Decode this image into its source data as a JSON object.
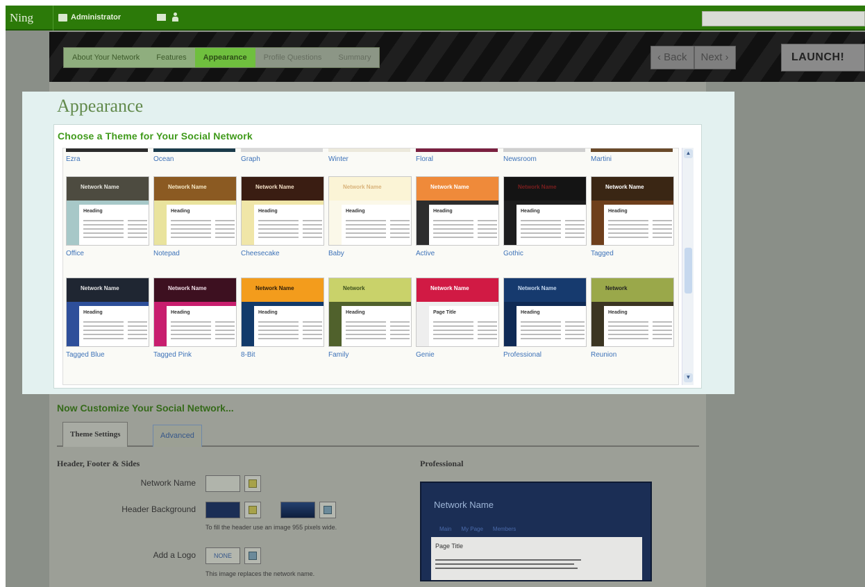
{
  "topbar": {
    "logo": "Ning",
    "admin_label": "Administrator",
    "search_placeholder": ""
  },
  "wizard": {
    "steps": [
      "About Your Network",
      "Features",
      "Appearance",
      "Profile Questions",
      "Summary"
    ],
    "back_label": "‹ Back",
    "next_label": "Next ›",
    "launch_label": "LAUNCH!"
  },
  "appearance": {
    "title": "Appearance",
    "choose_heading": "Choose a Theme for Your Social Network",
    "partial_row": [
      "Ezra",
      "Ocean",
      "Graph",
      "Winter",
      "Floral",
      "Newsroom",
      "Martini"
    ],
    "themes": [
      {
        "name": "Office",
        "hdr": "#4d4b40",
        "body": "#a7c8c8",
        "text_color": "#e7e7e0",
        "title": "Network Name",
        "heading": "Heading"
      },
      {
        "name": "Notepad",
        "hdr": "#8b5a22",
        "body": "#e9e39d",
        "text_color": "#f5e7c4",
        "title": "Network Name",
        "heading": "Heading"
      },
      {
        "name": "Cheesecake",
        "hdr": "#3a1d12",
        "body": "#f0e6a8",
        "text_color": "#f3dfc6",
        "title": "Network Name",
        "heading": "Heading"
      },
      {
        "name": "Baby",
        "hdr": "#fbf4d6",
        "body": "#fbf8e9",
        "text_color": "#d9b37a",
        "title": "Network Name",
        "heading": "Heading"
      },
      {
        "name": "Active",
        "hdr": "#ef8a3a",
        "body": "#2d2d2d",
        "text_color": "#fff",
        "title": "Network Name",
        "heading": "Heading"
      },
      {
        "name": "Gothic",
        "hdr": "#141414",
        "body": "#1d1d1d",
        "text_color": "#7a1f1f",
        "title": "Network Name",
        "heading": "Heading"
      },
      {
        "name": "Tagged",
        "hdr": "#3a2614",
        "body": "#6e3f1c",
        "text_color": "#fff",
        "title": "Network Name",
        "heading": "Heading"
      },
      {
        "name": "Tagged Blue",
        "hdr": "#1f2632",
        "body": "#2e4f9a",
        "text_color": "#e6e6e6",
        "title": "Network Name",
        "heading": "Heading"
      },
      {
        "name": "Tagged Pink",
        "hdr": "#3d1020",
        "body": "#c81e6e",
        "text_color": "#f0dde6",
        "title": "Network Name",
        "heading": "Heading"
      },
      {
        "name": "8-Bit",
        "hdr": "#f39c1c",
        "body": "#123a6a",
        "text_color": "#2b1c0a",
        "title": "Network Name",
        "heading": "Heading"
      },
      {
        "name": "Family",
        "hdr": "#c9d26a",
        "body": "#50612c",
        "text_color": "#3c4f1c",
        "title": "Network",
        "heading": "Heading"
      },
      {
        "name": "Genie",
        "hdr": "#d11a44",
        "body": "#eeeeee",
        "text_color": "#fff",
        "title": "Network Name",
        "heading": "Page Title"
      },
      {
        "name": "Professional",
        "hdr": "#163a6e",
        "body": "#0f2a55",
        "text_color": "#c6d8ee",
        "title": "Network Name",
        "heading": "Heading"
      },
      {
        "name": "Reunion",
        "hdr": "#9aa84a",
        "body": "#3b3522",
        "text_color": "#222",
        "title": "Network",
        "heading": "Heading"
      }
    ]
  },
  "customize": {
    "title": "Now Customize Your Social Network...",
    "tabs": [
      "Theme Settings",
      "Advanced"
    ],
    "section_title": "Header, Footer & Sides",
    "fields": {
      "network_name": "Network Name",
      "header_background": "Header Background",
      "header_hint": "To fill the header use an image 955 pixels wide.",
      "add_logo": "Add a Logo",
      "logo_none": "NONE",
      "logo_hint": "This image replaces the network name."
    },
    "preview": {
      "title": "Professional",
      "network_name": "Network Name",
      "nav": [
        "Main",
        "My Page",
        "Members"
      ],
      "page_title": "Page Title"
    }
  },
  "colors": {
    "topbar": "#2c7a09",
    "accent_green": "#3f9a1a",
    "link_blue": "#3d72b8"
  }
}
